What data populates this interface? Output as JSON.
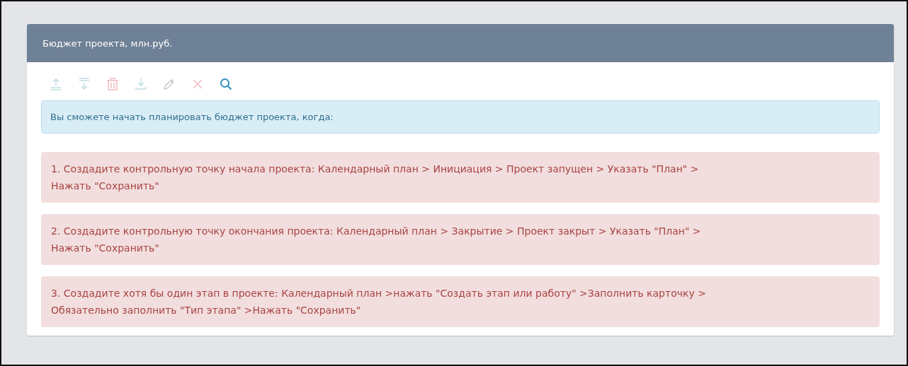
{
  "panel": {
    "title": "Бюджет проекта, млн.руб."
  },
  "toolbar": [
    {
      "kind": "move-up",
      "disabled": true
    },
    {
      "kind": "move-down",
      "disabled": true
    },
    {
      "kind": "delete",
      "disabled": true
    },
    {
      "kind": "import",
      "disabled": true
    },
    {
      "kind": "edit",
      "disabled": true
    },
    {
      "kind": "cancel",
      "disabled": true
    },
    {
      "kind": "search",
      "disabled": false
    }
  ],
  "info": {
    "text": "Вы сможете начать планировать бюджет проекта, когда:"
  },
  "conditions": [
    {
      "text": "1. Создадите контрольную точку начала проекта: Календарный план > Инициация > Проект запущен > Указать \"План\" > Нажать \"Сохранить\""
    },
    {
      "text": "2. Создадите контрольную точку окончания проекта: Календарный план > Закрытие > Проект закрыт > Указать \"План\" > Нажать \"Сохранить\""
    },
    {
      "text": "3. Создадите хотя бы один этап в проекте: Календарный план >нажать \"Создать этап или работу\" >Заполнить карточку > Обязательно заполнить \"Тип этапа\" >Нажать \"Сохранить\""
    }
  ]
}
